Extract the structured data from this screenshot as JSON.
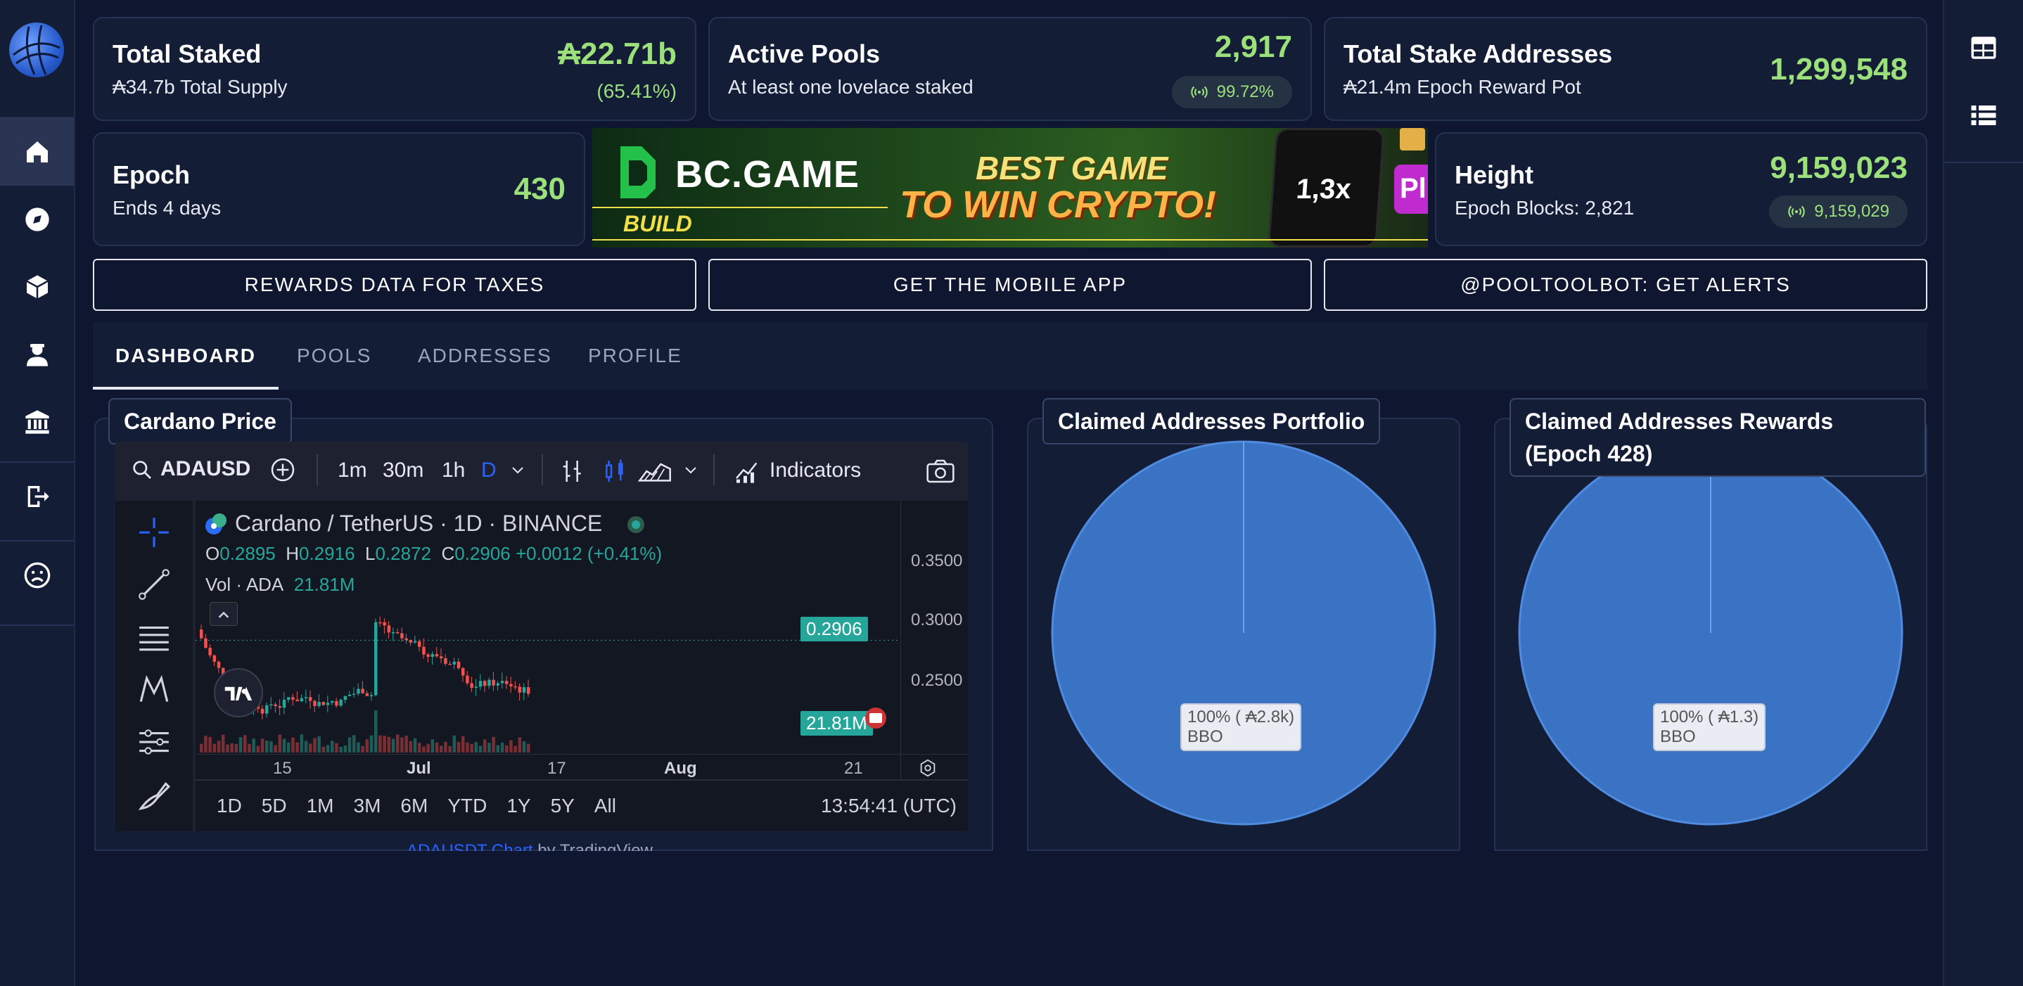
{
  "sidebar": {
    "items": [
      {
        "icon": "home-icon",
        "active": true
      },
      {
        "icon": "compass-icon"
      },
      {
        "icon": "cube-icon"
      },
      {
        "icon": "user-icon"
      },
      {
        "icon": "bank-icon"
      },
      {
        "icon": "logout-icon"
      },
      {
        "icon": "sad-face-icon"
      }
    ]
  },
  "rail": {
    "items": [
      {
        "icon": "table-icon"
      },
      {
        "icon": "list-icon"
      }
    ]
  },
  "stats": {
    "total_staked": {
      "title": "Total Staked",
      "subtitle": "₳34.7b Total Supply",
      "value": "₳22.71b",
      "percent": "(65.41%)"
    },
    "active_pools": {
      "title": "Active Pools",
      "subtitle": "At least one lovelace staked",
      "value": "2,917",
      "pill": "99.72%"
    },
    "total_stake_addresses": {
      "title": "Total Stake Addresses",
      "subtitle": "₳21.4m Epoch Reward Pot",
      "value": "1,299,548"
    },
    "epoch": {
      "title": "Epoch",
      "subtitle": "Ends 4 days",
      "value": "430"
    },
    "height": {
      "title": "Height",
      "subtitle": "Epoch Blocks: 2,821",
      "value": "9,159,023",
      "pill": "9,159,029"
    }
  },
  "ad": {
    "brand": "BC.GAME",
    "build": "BUILD",
    "line1": "BEST GAME",
    "line2": "TO WIN CRYPTO!",
    "multiplier": "1,3x",
    "pi": "Pl"
  },
  "buttons": {
    "taxes": "REWARDS DATA FOR TAXES",
    "mobile": "GET THE MOBILE APP",
    "alerts": "@POOLTOOLBOT: GET ALERTS"
  },
  "tabs": [
    "DASHBOARD",
    "POOLS",
    "ADDRESSES",
    "PROFILE"
  ],
  "cardano_price": {
    "title": "Cardano Price",
    "symbol": "ADAUSD",
    "intervals": [
      "1m",
      "30m",
      "1h",
      "D"
    ],
    "indicators": "Indicators",
    "pair": "Cardano / TetherUS · 1D · BINANCE",
    "ohlc": {
      "o_label": "O",
      "o": "0.2895",
      "h_label": "H",
      "h": "0.2916",
      "l_label": "L",
      "l": "0.2872",
      "c_label": "C",
      "c": "0.2906",
      "change": "+0.0012 (+0.41%)"
    },
    "vol_label": "Vol · ADA",
    "vol": "21.81M",
    "price_axis": [
      "0.3500",
      "0.3000",
      "0.2500"
    ],
    "last_price": "0.2906",
    "last_vol": "21.81M",
    "time_axis": [
      "15",
      "Jul",
      "17",
      "Aug",
      "21"
    ],
    "ranges": [
      "1D",
      "5D",
      "1M",
      "3M",
      "6M",
      "YTD",
      "1Y",
      "5Y",
      "All"
    ],
    "clock": "13:54:41 (UTC)",
    "credit_link": "ADAUSDT Chart",
    "credit_suffix": "by TradingView"
  },
  "portfolio": {
    "title": "Claimed Addresses Portfolio",
    "slice_label": "100% ( ₳2.8k)",
    "slice_name": "BBO"
  },
  "rewards": {
    "title": "Claimed Addresses Rewards (Epoch 428)",
    "slice_label": "100% ( ₳1.3)",
    "slice_name": "BBO"
  },
  "colors": {
    "accent_green": "#9be07b",
    "pie_blue": "#3b73c4",
    "bg": "#0f1730",
    "card": "#141d36"
  }
}
